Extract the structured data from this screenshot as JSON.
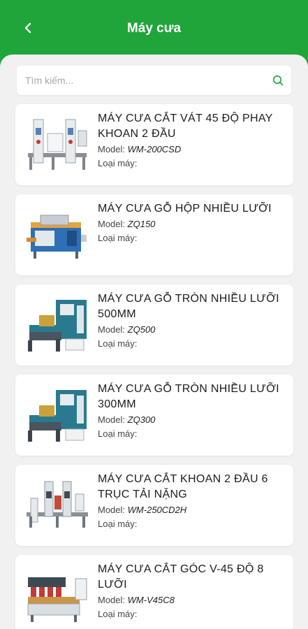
{
  "header": {
    "title": "Máy cưa"
  },
  "search": {
    "placeholder": "Tìm kiếm..."
  },
  "labels": {
    "model": "Model:",
    "type": "Loại máy:"
  },
  "colors": {
    "brand_green": "#1fa53a",
    "panel_bg": "#f1f1f1",
    "card_bg": "#ffffff",
    "search_icon": "#1fa53a"
  },
  "products": [
    {
      "name": "MÁY CƯA CẮT VÁT 45 ĐỘ PHAY KHOAN 2 ĐẦU",
      "model": "WM-200CSD",
      "type": "",
      "image": "twin-vertical-machine"
    },
    {
      "name": "MÁY CƯA GỖ HỘP NHIỀU LƯỠI",
      "model": "ZQ150",
      "type": "",
      "image": "box-saw-machine"
    },
    {
      "name": "MÁY CƯA GỖ TRÒN NHIỀU LƯỠI 500MM",
      "model": "ZQ500",
      "type": "",
      "image": "round-saw-machine"
    },
    {
      "name": "MÁY CƯA GỖ TRÒN NHIỀU LƯỠI 300MM",
      "model": "ZQ300",
      "type": "",
      "image": "round-saw-machine"
    },
    {
      "name": "MÁY CƯA CẮT KHOAN 2 ĐẦU 6 TRỤC TẢI NẶNG",
      "model": "WM-250CD2H",
      "type": "",
      "image": "twin-head-drill-machine"
    },
    {
      "name": "MÁY CƯA CẮT GÓC V-45 ĐỘ 8 LƯỠI",
      "model": "WM-V45C8",
      "type": "",
      "image": "v-angle-saw-machine"
    }
  ]
}
